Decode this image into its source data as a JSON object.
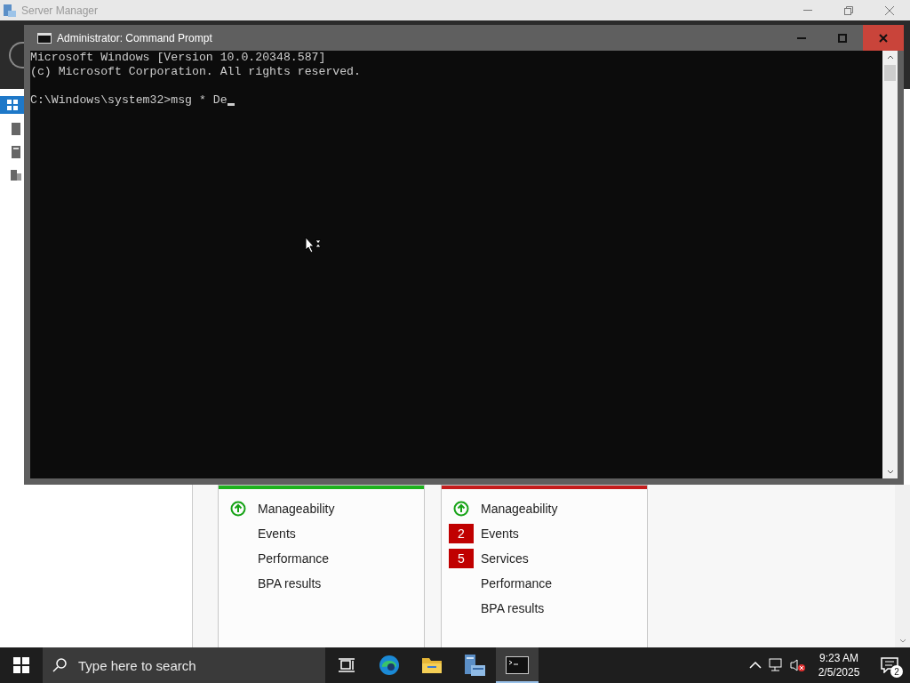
{
  "server_manager": {
    "title": "Server Manager",
    "cards": [
      {
        "color": "#1db21d",
        "items": [
          {
            "kind": "up",
            "label": "Manageability"
          },
          {
            "kind": "none",
            "label": "Events"
          },
          {
            "kind": "none",
            "label": "Performance"
          },
          {
            "kind": "none",
            "label": "BPA results"
          }
        ]
      },
      {
        "color": "#c41e1e",
        "items": [
          {
            "kind": "up",
            "label": "Manageability"
          },
          {
            "kind": "count",
            "count": "2",
            "label": "Events"
          },
          {
            "kind": "count",
            "count": "5",
            "label": "Services"
          },
          {
            "kind": "none",
            "label": "Performance"
          },
          {
            "kind": "none",
            "label": "BPA results"
          }
        ]
      }
    ]
  },
  "command_prompt": {
    "title": "Administrator: Command Prompt",
    "lines": [
      "Microsoft Windows [Version 10.0.20348.587]",
      "(c) Microsoft Corporation. All rights reserved."
    ],
    "prompt": "C:\\Windows\\system32>msg * De"
  },
  "taskbar": {
    "search": {
      "placeholder": "Type here to search"
    },
    "apps": [
      {
        "kind": "taskview",
        "selected": false
      },
      {
        "kind": "browser",
        "selected": false
      },
      {
        "kind": "folder",
        "selected": false
      },
      {
        "kind": "server",
        "selected": false
      },
      {
        "kind": "terminal",
        "selected": true
      }
    ],
    "time": "9:23 AM",
    "date": "2/5/2025",
    "notifications": "2"
  }
}
